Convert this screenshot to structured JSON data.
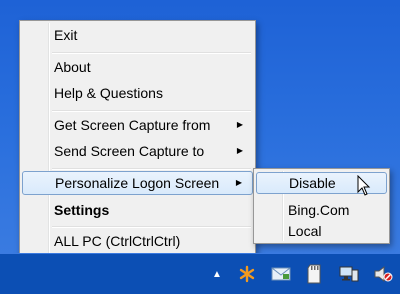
{
  "menu": {
    "exit": "Exit",
    "about": "About",
    "help": "Help & Questions",
    "get_capture": "Get Screen Capture from",
    "send_capture": "Send Screen Capture to",
    "personalize": "Personalize Logon Screen",
    "settings": "Settings",
    "all_pc": "ALL PC (CtrlCtrlCtrl)",
    "submenu_arrow": "▶"
  },
  "submenu": {
    "disable": "Disable",
    "bing": "Bing.Com",
    "local": "Local"
  },
  "tray": {
    "show_hidden": "▲",
    "icons": [
      "asterisk-icon",
      "mail-icon",
      "sd-card-icon",
      "network-icon",
      "volume-muted-icon"
    ]
  },
  "colors": {
    "desktop": "#2a6fdd",
    "taskbar": "#0c4fb4",
    "menu_bg": "#f0f0f0",
    "highlight_border": "#7da2ce"
  }
}
